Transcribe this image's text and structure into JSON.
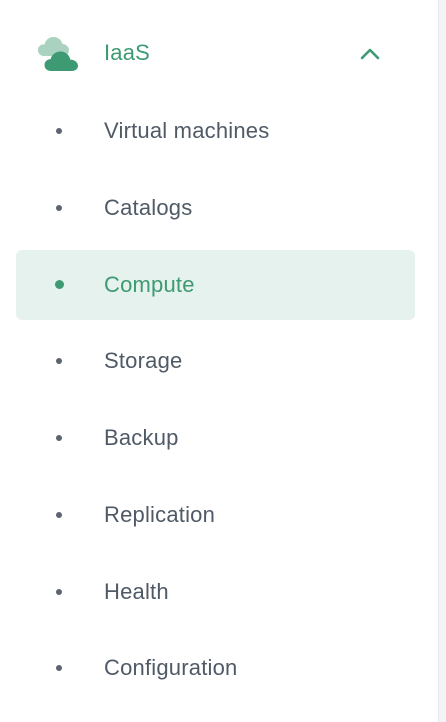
{
  "section": {
    "title": "IaaS",
    "icon": "cloud-icon",
    "expanded": true,
    "toggle_icon": "chevron-up-icon"
  },
  "nav": {
    "items": [
      {
        "label": "Virtual machines",
        "active": false
      },
      {
        "label": "Catalogs",
        "active": false
      },
      {
        "label": "Compute",
        "active": true
      },
      {
        "label": "Storage",
        "active": false
      },
      {
        "label": "Backup",
        "active": false
      },
      {
        "label": "Replication",
        "active": false
      },
      {
        "label": "Health",
        "active": false
      },
      {
        "label": "Configuration",
        "active": false
      }
    ]
  },
  "colors": {
    "accent": "#3d9a72",
    "accent_bg": "#e6f2ed",
    "text": "#505a66",
    "cloud_light": "#a9d3c0"
  }
}
